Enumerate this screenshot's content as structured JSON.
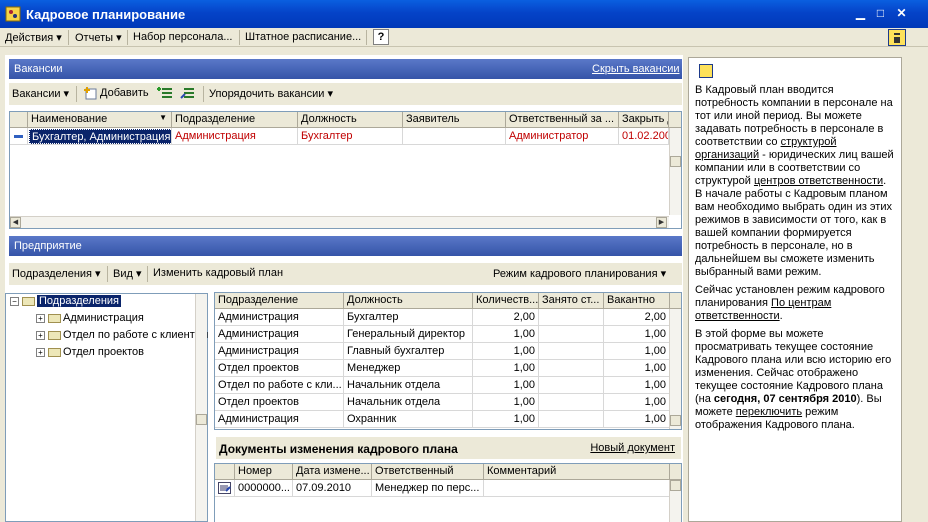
{
  "window": {
    "title": "Кадровое планирование"
  },
  "menu": {
    "items": [
      "Действия ▾",
      "Отчеты ▾",
      "Набор персонала...",
      "Штатное расписание..."
    ],
    "help": "?"
  },
  "vacancies": {
    "section_title": "Вакансии",
    "hide_link": "Скрыть вакансии",
    "toolbar": {
      "vacancies_menu": "Вакансии ▾",
      "add": "Добавить",
      "sort": "Упорядочить вакансии ▾"
    },
    "columns": [
      "Наименование",
      "Подразделение",
      "Должность",
      "Заявитель",
      "Ответственный за ...",
      "Закрыть д"
    ],
    "rows": [
      [
        "Бухгалтер, Администрация",
        "Администрация",
        "Бухгалтер",
        "",
        "Администратор",
        "01.02.200"
      ]
    ]
  },
  "enterprise": {
    "section_title": "Предприятие",
    "toolbar": {
      "divisions": "Подразделения ▾",
      "view": "Вид ▾",
      "change_plan": "Изменить кадровый план",
      "mode": "Режим кадрового планирования ▾"
    },
    "tree": [
      {
        "label": "Подразделения",
        "level": 0,
        "selected": true
      },
      {
        "label": "Администрация",
        "level": 1,
        "selected": false
      },
      {
        "label": "Отдел по работе с клиентами",
        "level": 1,
        "selected": false
      },
      {
        "label": "Отдел проектов",
        "level": 1,
        "selected": false
      }
    ],
    "plan_columns": [
      "Подразделение",
      "Должность",
      "Количеств...",
      "Занято ст...",
      "Вакантно"
    ],
    "plan_rows": [
      [
        "Администрация",
        "Бухгалтер",
        "2,00",
        "",
        "2,00"
      ],
      [
        "Администрация",
        "Генеральный директор",
        "1,00",
        "",
        "1,00"
      ],
      [
        "Администрация",
        "Главный бухгалтер",
        "1,00",
        "",
        "1,00"
      ],
      [
        "Отдел проектов",
        "Менеджер",
        "1,00",
        "",
        "1,00"
      ],
      [
        "Отдел по работе с кли...",
        "Начальник отдела",
        "1,00",
        "",
        "1,00"
      ],
      [
        "Отдел проектов",
        "Начальник отдела",
        "1,00",
        "",
        "1,00"
      ],
      [
        "Администрация",
        "Охранник",
        "1,00",
        "",
        "1,00"
      ]
    ]
  },
  "documents": {
    "title": "Документы изменения кадрового плана",
    "new_link": "Новый документ",
    "columns": [
      "",
      "Номер",
      "Дата измене...",
      "Ответственный",
      "Комментарий"
    ],
    "rows": [
      [
        "",
        "0000000...",
        "07.09.2010",
        "Менеджер по перс...",
        ""
      ]
    ]
  },
  "help_panel": {
    "p1_a": "В Кадровый план вводится потребность компании в персонале на тот или иной период. Вы можете задавать потребность в персонале в соответствии со ",
    "p1_link1": "структурой организаций",
    "p1_b": " - юридических лиц вашей компании или в соответствии со структурой ",
    "p1_link2": "центров ответственности",
    "p1_c": ". В начале работы с Кадровым планом вам необходимо выбрать один из этих режимов в зависимости от того, как в вашей компании формируется потребность в персонале, но в дальнейшем вы сможете изменить выбранный вами режим.",
    "p2_a": "Сейчас установлен режим кадрового планирования ",
    "p2_link": "По центрам ответственности",
    "p2_b": ".",
    "p3_a": "В этой форме вы можете просматривать текущее состояние Кадрового плана или всю историю его изменения. Сейчас отображено текущее состояние Кадрового плана (на ",
    "p3_bold": "сегодня, 07 сентября 2010",
    "p3_b": "). Вы можете ",
    "p3_link": "переключить",
    "p3_c": " режим отображения Кадрового плана."
  }
}
